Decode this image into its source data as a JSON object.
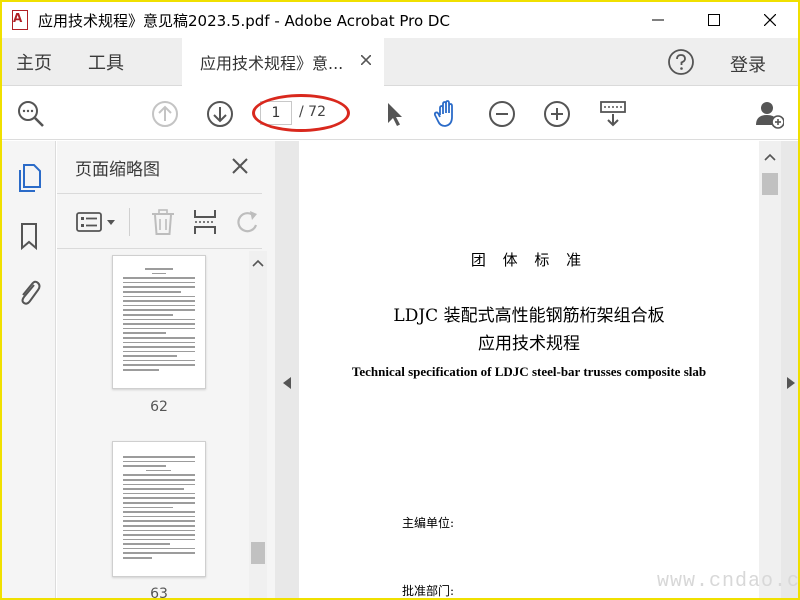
{
  "window": {
    "title": "应用技术规程》意见稿2023.5.pdf - Adobe Acrobat Pro DC"
  },
  "tabs": {
    "home": "主页",
    "tools": "工具",
    "document": "应用技术规程》意...",
    "signin": "登录"
  },
  "toolbar": {
    "current_page": "1",
    "total_pages": "/ 72"
  },
  "thumbnails_panel": {
    "title": "页面缩略图",
    "pages": [
      {
        "label": "62"
      },
      {
        "label": "63"
      }
    ]
  },
  "document": {
    "standard_type": "团 体 标 准",
    "title_line1": "LDJC 装配式高性能钢筋桁架组合板",
    "title_line2": "应用技术规程",
    "english_title": "Technical specification of LDJC steel-bar trusses composite slab",
    "field_editor": "主编单位:",
    "field_approval": "批准部门:"
  },
  "watermark": "www.cndao.com",
  "colors": {
    "accent_blue": "#2b6bc8",
    "annotation_red": "#d9281d",
    "acrobat_red": "#b01e23"
  },
  "icons": {
    "app": "acrobat-icon",
    "zoom": "search-zoom-icon",
    "prev": "arrow-up-circle-icon",
    "next": "arrow-down-circle-icon",
    "select": "pointer-icon",
    "hand": "hand-icon",
    "zoom_out": "minus-circle-icon",
    "zoom_in": "plus-circle-icon",
    "fit": "fit-page-icon",
    "share": "add-user-icon"
  }
}
